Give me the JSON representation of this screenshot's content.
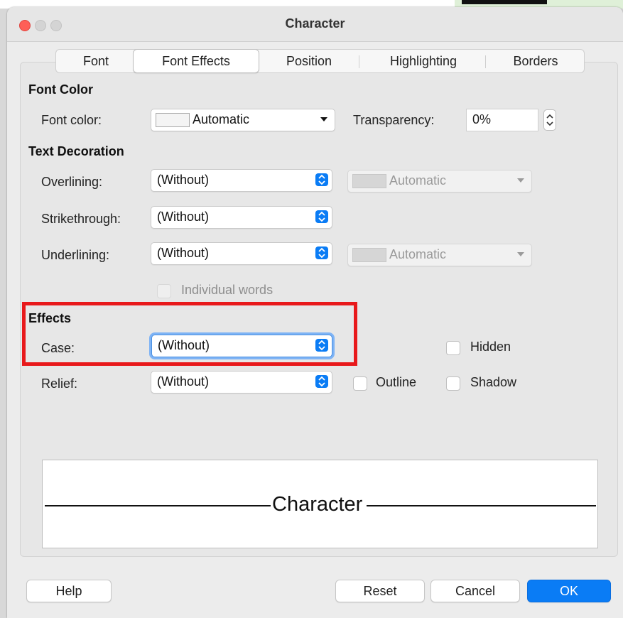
{
  "window": {
    "title": "Character"
  },
  "tabs": [
    "Font",
    "Font Effects",
    "Position",
    "Highlighting",
    "Borders"
  ],
  "active_tab": "Font Effects",
  "font_color": {
    "section": "Font Color",
    "font_color_label": "Font color:",
    "font_color_value": "Automatic",
    "transparency_label": "Transparency:",
    "transparency_value": "0%"
  },
  "text_decoration": {
    "section": "Text Decoration",
    "overlining_label": "Overlining:",
    "overlining_value": "(Without)",
    "overlining_color": "Automatic",
    "strikethrough_label": "Strikethrough:",
    "strikethrough_value": "(Without)",
    "underlining_label": "Underlining:",
    "underlining_value": "(Without)",
    "underlining_color": "Automatic",
    "individual_words_label": "Individual words"
  },
  "effects": {
    "section": "Effects",
    "case_label": "Case:",
    "case_value": "(Without)",
    "relief_label": "Relief:",
    "relief_value": "(Without)",
    "hidden_label": "Hidden",
    "outline_label": "Outline",
    "shadow_label": "Shadow"
  },
  "preview": {
    "text": "Character"
  },
  "buttons": {
    "help": "Help",
    "reset": "Reset",
    "cancel": "Cancel",
    "ok": "OK"
  },
  "colors": {
    "accent": "#0a7cf5",
    "highlight_box": "#e8191b",
    "close_button": "#fe5f57"
  }
}
